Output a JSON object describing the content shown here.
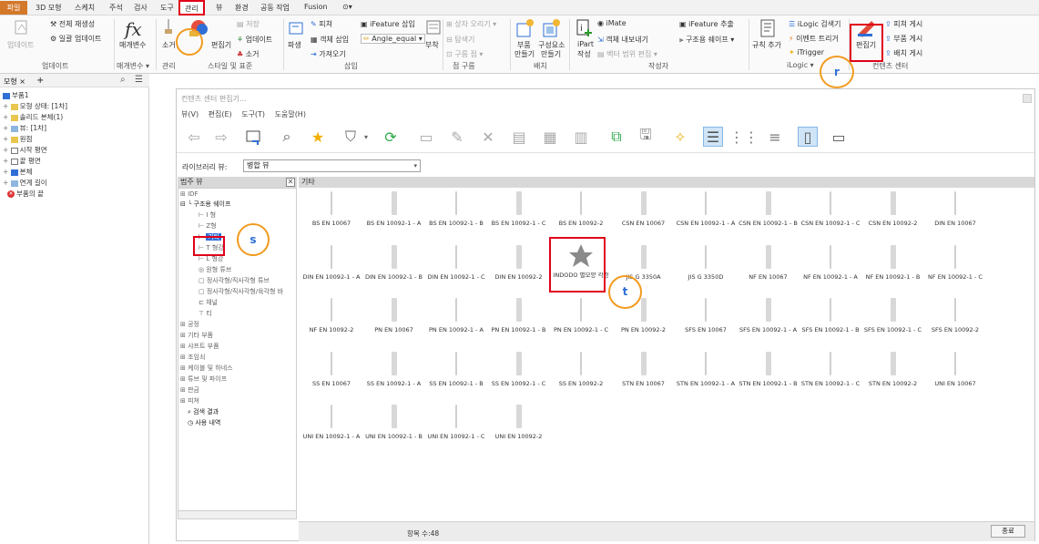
{
  "menubar": {
    "tabs": [
      "파일",
      "3D 모형",
      "스케치",
      "주석",
      "검사",
      "도구",
      "관리",
      "뷰",
      "환경",
      "공동 작업",
      "Fusion",
      "⊙▾"
    ]
  },
  "ribbon": {
    "update_group": {
      "label": "업데이트",
      "btn": "업데이트",
      "rebuild_all": "전체 재생성",
      "regen_all": "일괄 업데이트"
    },
    "param_group": {
      "label": "매개변수 ▾",
      "btn": "매개변수"
    },
    "manage_group": {
      "label": "관리",
      "btn": "소거"
    },
    "style_group": {
      "label": "스타일 및 표준",
      "editor": "편집기",
      "save": "저장",
      "update": "업데이트",
      "purge": "소거"
    },
    "insert_group": {
      "label": "삽입",
      "derive": "파생",
      "item1": "피쳐",
      "item2": "객체 삽입",
      "item3": "가져오기",
      "ifeature": "iFeature 삽입",
      "angle": "Angle_equal ▾",
      "attach": "부착"
    },
    "point_group": {
      "label": "점 구름",
      "item1": "상자 오리기 ▾",
      "item2": "탐색기",
      "item3": "구름 점 ▾"
    },
    "layout_group": {
      "label": "배치",
      "part": "부품",
      "make": "만들기",
      "component": "구성요소",
      "make2": "만들기"
    },
    "author_group": {
      "label": "작성자",
      "ipart": "iPart",
      "create": "작성",
      "imate": "iMate",
      "export": "객체 내보내기",
      "vector": "벡터 범위 편집 ▾",
      "ifeature_extract": "iFeature 추출",
      "struct": "구조용 쉐이프 ▾"
    },
    "ilogic_group": {
      "label": "iLogic ▾",
      "rule": "규칙 추가",
      "browser": "iLogic 검색기",
      "event": "이벤트 트리거",
      "itrigger": "iTrigger"
    },
    "content_group": {
      "label": "컨텐츠 센터",
      "editor": "편집기",
      "feature_publish": "피쳐 게시",
      "part_publish": "부품 게시",
      "layout_publish": "배치 게시"
    }
  },
  "browser": {
    "tabs": [
      "모형 ×",
      "+"
    ],
    "rows": [
      "부품1",
      "모형 상태: [1차]",
      "솔리드 본체(1)",
      "뷰: [1차]",
      "원점",
      "시작 평면",
      "끝 평면",
      "본체",
      "연계 길이",
      "부품의 끝"
    ]
  },
  "dialog": {
    "title": "컨텐츠 센터 편집기...",
    "menu": [
      "뷰(V)",
      "편집(E)",
      "도구(T)",
      "도움말(H)"
    ],
    "library_label": "라이브러리 뷰:",
    "library_value": "병합 뷰",
    "category_header": "범주 뷰",
    "items_header": "기타",
    "count_label": "항목 수:48",
    "close_label": "종료",
    "categories": [
      "IDF",
      "구조용 쉐이프",
      "I 형",
      "Z형",
      "기타",
      "T 형강",
      "L 형강",
      "원형 튜브",
      "정사각형/직사각형 튜브",
      "정사각형/직사각형/육각형 바",
      "채널",
      "티",
      "공정",
      "기타 부품",
      "샤프트 부품",
      "조임쇠",
      "케이블 및 하네스",
      "튜브 및 파이프",
      "판금",
      "피쳐",
      "검색 결과",
      "사용 내역"
    ],
    "items": [
      "BS EN 10067",
      "BS EN 10092-1 - A",
      "BS EN 10092-1 - B",
      "BS EN 10092-1 - C",
      "BS EN 10092-2",
      "CSN EN 10067",
      "CSN EN 10092-1 - A",
      "CSN EN 10092-1 - B",
      "CSN EN 10092-1 - C",
      "CSN EN 10092-2",
      "DIN EN 10067",
      "DIN EN 10092-1 - A",
      "DIN EN 10092-1 - B",
      "DIN EN 10092-1 - C",
      "DIN EN 10092-2",
      "INDODO 별모양 각관",
      "JIS G 3350A",
      "JIS G 3350D",
      "NF EN 10067",
      "NF EN 10092-1 - A",
      "NF EN 10092-1 - B",
      "NF EN 10092-1 - C",
      "NF EN 10092-2",
      "PN EN 10067",
      "PN EN 10092-1 - A",
      "PN EN 10092-1 - B",
      "PN EN 10092-1 - C",
      "PN EN 10092-2",
      "SFS EN 10067",
      "SFS EN 10092-1 - A",
      "SFS EN 10092-1 - B",
      "SFS EN 10092-1 - C",
      "SFS EN 10092-2",
      "SS EN 10067",
      "SS EN 10092-1 - A",
      "SS EN 10092-1 - B",
      "SS EN 10092-1 - C",
      "SS EN 10092-2",
      "STN EN 10067",
      "STN EN 10092-1 - A",
      "STN EN 10092-1 - B",
      "STN EN 10092-1 - C",
      "STN EN 10092-2",
      "UNI EN 10067",
      "UNI EN 10092-1 - A",
      "UNI EN 10092-1 - B",
      "UNI EN 10092-1 - C",
      "UNI EN 10092-2"
    ]
  },
  "annotations": {
    "s": "s",
    "t": "t",
    "r": "r"
  },
  "colors": {
    "highlight_red": "#e0001a",
    "highlight_orange": "#f29b1f",
    "file_tab": "#d4782a",
    "accent_blue": "#2f6fd6"
  }
}
